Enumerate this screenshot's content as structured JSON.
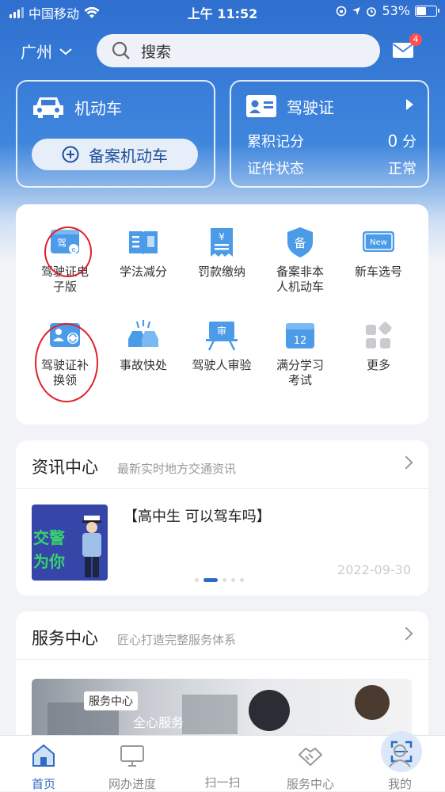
{
  "status_bar": {
    "carrier": "中国移动",
    "time": "上午 11:52",
    "battery": "53%"
  },
  "header": {
    "city": "广州",
    "search_placeholder": "搜索",
    "mail_badge": "4"
  },
  "vehicle_card": {
    "title": "机动车",
    "register_button": "备案机动车"
  },
  "license_card": {
    "title": "驾驶证",
    "points_label": "累积记分",
    "points_value": "0",
    "points_unit": "分",
    "status_label": "证件状态",
    "status_value": "正常"
  },
  "services": [
    {
      "label_l1": "驾驶证电",
      "label_l2": "子版",
      "icon": "e-license-icon"
    },
    {
      "label_l1": "学法减分",
      "label_l2": "",
      "icon": "book-icon"
    },
    {
      "label_l1": "罚款缴纳",
      "label_l2": "",
      "icon": "receipt-yuan-icon"
    },
    {
      "label_l1": "备案非本",
      "label_l2": "人机动车",
      "icon": "shield-bei-icon"
    },
    {
      "label_l1": "新车选号",
      "label_l2": "",
      "icon": "new-plate-icon"
    },
    {
      "label_l1": "驾驶证补",
      "label_l2": "换领",
      "icon": "license-exchange-icon"
    },
    {
      "label_l1": "事故快处",
      "label_l2": "",
      "icon": "car-accident-icon"
    },
    {
      "label_l1": "驾驶人审验",
      "label_l2": "",
      "icon": "audit-icon"
    },
    {
      "label_l1": "满分学习",
      "label_l2": "考试",
      "icon": "calendar-12-icon"
    },
    {
      "label_l1": "更多",
      "label_l2": "",
      "icon": "more-grid-icon"
    }
  ],
  "service_icon_labels": {
    "jia": "驾",
    "new": "New",
    "bei": "备",
    "shen": "审",
    "twelve": "12",
    "yuan": "¥"
  },
  "news": {
    "title": "资讯中心",
    "subtitle": "最新实时地方交通资讯",
    "item_title": "【高中生 可以驾车吗】",
    "item_date": "2022-09-30",
    "thumb_text_1": "交警",
    "thumb_text_2": "为你"
  },
  "service_center": {
    "title": "服务中心",
    "subtitle": "匠心打造完整服务体系",
    "banner_tag": "服务中心",
    "banner_text": "全心服务"
  },
  "tabs": [
    {
      "label": "首页",
      "active": true
    },
    {
      "label": "网办进度",
      "active": false
    },
    {
      "label": "扫一扫",
      "active": false
    },
    {
      "label": "服务中心",
      "active": false
    },
    {
      "label": "我的",
      "active": false
    }
  ],
  "colors": {
    "primary": "#2d6cc4",
    "annotation_red": "#e0202a"
  }
}
